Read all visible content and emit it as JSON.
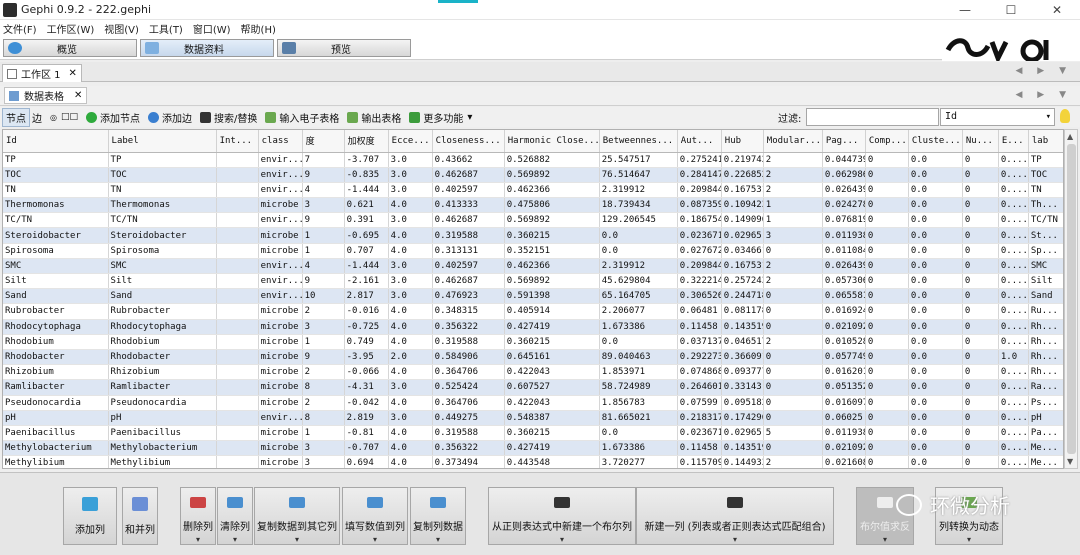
{
  "window": {
    "title": "Gephi 0.9.2 - 222.gephi",
    "min": "—",
    "max": "☐",
    "close": "✕"
  },
  "menu": [
    "文件(F)",
    "工作区(W)",
    "视图(V)",
    "工具(T)",
    "窗口(W)",
    "帮助(H)"
  ],
  "modes": [
    "概览",
    "数据资料",
    "预览"
  ],
  "workspace_tab": {
    "label": "工作区 1",
    "close": "✕"
  },
  "nav_arrows": "◀ ▶ ▼",
  "datalab": {
    "tab_label": "数据表格",
    "close": "✕"
  },
  "toolbar": {
    "nodes": "节点",
    "edges": "边",
    "add_node": "添加节点",
    "add_edge": "添加边",
    "search_replace": "搜索/替换",
    "import_sheet": "输入电子表格",
    "export_table": "输出表格",
    "more": "更多功能",
    "more_arrow": "▾"
  },
  "filter": {
    "label": "过滤:",
    "value": "",
    "column": "Id",
    "arrow": "▾"
  },
  "table": {
    "columns": [
      "Id",
      "Label",
      "Int...",
      "class",
      "度",
      "加权度",
      "Ecce...",
      "Closeness...",
      "Harmonic Close...",
      "Betweennes...",
      "Aut...",
      "Hub",
      "Modular...",
      "Pag...",
      "Comp...",
      "Cluste...",
      "Nu...",
      "E...",
      "lab"
    ],
    "rows": [
      [
        "TP",
        "TP",
        "",
        "envir...",
        "7",
        "-3.707",
        "3.0",
        "0.43662",
        "0.526882",
        "25.547517",
        "0.275241",
        "0.219742",
        "2",
        "0.044739",
        "0",
        "0.0",
        "0",
        "0....",
        "TP"
      ],
      [
        "TOC",
        "TOC",
        "",
        "envir...",
        "9",
        "-0.835",
        "3.0",
        "0.462687",
        "0.569892",
        "76.514647",
        "0.284147",
        "0.226852",
        "2",
        "0.062986",
        "0",
        "0.0",
        "0",
        "0....",
        "TOC"
      ],
      [
        "TN",
        "TN",
        "",
        "envir...",
        "4",
        "-1.444",
        "3.0",
        "0.402597",
        "0.462366",
        "2.319912",
        "0.209844",
        "0.167531",
        "2",
        "0.026439",
        "0",
        "0.0",
        "0",
        "0....",
        "TN"
      ],
      [
        "Thermomonas",
        "Thermomonas",
        "",
        "microbe",
        "3",
        "0.621",
        "4.0",
        "0.413333",
        "0.475806",
        "18.739434",
        "0.087359",
        "0.109423",
        "1",
        "0.024278",
        "0",
        "0.0",
        "0",
        "0....",
        "Th..."
      ],
      [
        "TC/TN",
        "TC/TN",
        "",
        "envir...",
        "9",
        "0.391",
        "3.0",
        "0.462687",
        "0.569892",
        "129.206545",
        "0.186754",
        "0.149096",
        "1",
        "0.076819",
        "0",
        "0.0",
        "0",
        "0....",
        "TC/TN"
      ],
      [
        "Steroidobacter",
        "Steroidobacter",
        "",
        "microbe",
        "1",
        "-0.695",
        "4.0",
        "0.319588",
        "0.360215",
        "0.0",
        "0.023671",
        "0.02965",
        "3",
        "0.011938",
        "0",
        "0.0",
        "0",
        "0....",
        "St..."
      ],
      [
        "Spirosoma",
        "Spirosoma",
        "",
        "microbe",
        "1",
        "0.707",
        "4.0",
        "0.313131",
        "0.352151",
        "0.0",
        "0.027672",
        "0.034661",
        "0",
        "0.011084",
        "0",
        "0.0",
        "0",
        "0....",
        "Sp..."
      ],
      [
        "SMC",
        "SMC",
        "",
        "envir...",
        "4",
        "-1.444",
        "3.0",
        "0.402597",
        "0.462366",
        "2.319912",
        "0.209844",
        "0.167531",
        "2",
        "0.026439",
        "0",
        "0.0",
        "0",
        "0....",
        "SMC"
      ],
      [
        "Silt",
        "Silt",
        "",
        "envir...",
        "9",
        "-2.161",
        "3.0",
        "0.462687",
        "0.569892",
        "45.629804",
        "0.322214",
        "0.257243",
        "2",
        "0.057306",
        "0",
        "0.0",
        "0",
        "0....",
        "Silt"
      ],
      [
        "Sand",
        "Sand",
        "",
        "envir...",
        "10",
        "2.817",
        "3.0",
        "0.476923",
        "0.591398",
        "65.164705",
        "0.306526",
        "0.244718",
        "0",
        "0.065581",
        "0",
        "0.0",
        "0",
        "0....",
        "Sand"
      ],
      [
        "Rubrobacter",
        "Rubrobacter",
        "",
        "microbe",
        "2",
        "-0.016",
        "4.0",
        "0.348315",
        "0.405914",
        "2.206077",
        "0.06481",
        "0.081178",
        "0",
        "0.016924",
        "0",
        "0.0",
        "0",
        "0....",
        "Ru..."
      ],
      [
        "Rhodocytophaga",
        "Rhodocytophaga",
        "",
        "microbe",
        "3",
        "-0.725",
        "4.0",
        "0.356322",
        "0.427419",
        "1.673386",
        "0.11458",
        "0.143519",
        "0",
        "0.021092",
        "0",
        "0.0",
        "0",
        "0....",
        "Rh..."
      ],
      [
        "Rhodobium",
        "Rhodobium",
        "",
        "microbe",
        "1",
        "0.749",
        "4.0",
        "0.319588",
        "0.360215",
        "0.0",
        "0.037137",
        "0.046517",
        "2",
        "0.010528",
        "0",
        "0.0",
        "0",
        "0....",
        "Rh..."
      ],
      [
        "Rhodobacter",
        "Rhodobacter",
        "",
        "microbe",
        "9",
        "-3.95",
        "2.0",
        "0.584906",
        "0.645161",
        "89.040463",
        "0.292273",
        "0.366091",
        "0",
        "0.057749",
        "0",
        "0.0",
        "0",
        "1.0",
        "Rh..."
      ],
      [
        "Rhizobium",
        "Rhizobium",
        "",
        "microbe",
        "2",
        "-0.066",
        "4.0",
        "0.364706",
        "0.422043",
        "1.853971",
        "0.074868",
        "0.093777",
        "0",
        "0.016201",
        "0",
        "0.0",
        "0",
        "0....",
        "Rh..."
      ],
      [
        "Ramlibacter",
        "Ramlibacter",
        "",
        "microbe",
        "8",
        "-4.31",
        "3.0",
        "0.525424",
        "0.607527",
        "58.724989",
        "0.264601",
        "0.33143",
        "0",
        "0.051352",
        "0",
        "0.0",
        "0",
        "0....",
        "Ra..."
      ],
      [
        "Pseudonocardia",
        "Pseudonocardia",
        "",
        "microbe",
        "2",
        "-0.042",
        "4.0",
        "0.364706",
        "0.422043",
        "1.856783",
        "0.07599",
        "0.095182",
        "0",
        "0.016097",
        "0",
        "0.0",
        "0",
        "0....",
        "Ps..."
      ],
      [
        "pH",
        "pH",
        "",
        "envir...",
        "8",
        "2.819",
        "3.0",
        "0.449275",
        "0.548387",
        "81.665021",
        "0.218317",
        "0.174296",
        "0",
        "0.06025",
        "0",
        "0.0",
        "0",
        "0....",
        "pH"
      ],
      [
        "Paenibacillus",
        "Paenibacillus",
        "",
        "microbe",
        "1",
        "-0.81",
        "4.0",
        "0.319588",
        "0.360215",
        "0.0",
        "0.023671",
        "0.02965",
        "5",
        "0.011938",
        "0",
        "0.0",
        "0",
        "0....",
        "Pa..."
      ],
      [
        "Methylobacterium",
        "Methylobacterium",
        "",
        "microbe",
        "3",
        "-0.707",
        "4.0",
        "0.356322",
        "0.427419",
        "1.673386",
        "0.11458",
        "0.143519",
        "0",
        "0.021092",
        "0",
        "0.0",
        "0",
        "0....",
        "Me..."
      ],
      [
        "Methylibium",
        "Methylibium",
        "",
        "microbe",
        "3",
        "0.694",
        "4.0",
        "0.373494",
        "0.443548",
        "3.720277",
        "0.115709",
        "0.144933",
        "2",
        "0.021608",
        "0",
        "0.0",
        "0",
        "0....",
        "Me..."
      ]
    ]
  },
  "bottom_buttons": [
    {
      "label": "添加列",
      "chev": ""
    },
    {
      "label": "和并列",
      "chev": ""
    },
    {
      "label": "删除列",
      "chev": "▾"
    },
    {
      "label": "清除列",
      "chev": "▾"
    },
    {
      "label": "复制数据到其它列",
      "chev": "▾"
    },
    {
      "label": "填写数值到列",
      "chev": "▾"
    },
    {
      "label": "复制列数据",
      "chev": "▾"
    },
    {
      "label": "从正则表达式中新建一个布尔列",
      "chev": "▾"
    },
    {
      "label": "新建一列 (列表或者正则表达式匹配组合)",
      "chev": "▾"
    },
    {
      "label": "布尔值求反",
      "chev": "▾"
    },
    {
      "label": "列转换为动态",
      "chev": "▾"
    }
  ],
  "watermark": "环微分析",
  "colors": {
    "row_alt": "#dde6f3",
    "accent": "#1ab3c8"
  }
}
